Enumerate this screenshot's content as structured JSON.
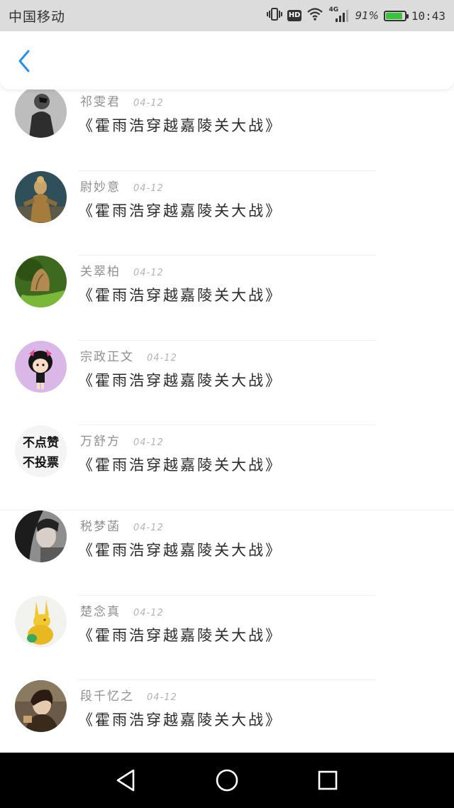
{
  "status_bar": {
    "carrier": "中国移动",
    "network_badge": "HD",
    "network_type": "4G",
    "battery_percent": "91%",
    "battery_level": 0.91,
    "time": "10:43"
  },
  "header": {
    "back_icon": "chevron-left-icon",
    "accent_color": "#2a8ef0"
  },
  "comments": [
    {
      "username": "祁雯君",
      "date": "04-12",
      "text": "《霍雨浩穿越嘉陵关大战》",
      "avatar": "grayscale-person-photo"
    },
    {
      "username": "尉妙意",
      "date": "04-12",
      "text": "《霍雨浩穿越嘉陵关大战》",
      "avatar": "statue-figure-photo"
    },
    {
      "username": "关翠柏",
      "date": "04-12",
      "text": "《霍雨浩穿越嘉陵关大战》",
      "avatar": "butterfly-photo"
    },
    {
      "username": "宗政正文",
      "date": "04-12",
      "text": "《霍雨浩穿越嘉陵关大战》",
      "avatar": "cartoon-girl-photo"
    },
    {
      "username": "万舒方",
      "date": "04-12",
      "text": "《霍雨浩穿越嘉陵关大战》",
      "avatar": "text-image",
      "avatar_text_line1": "不点赞",
      "avatar_text_line2": "不投票"
    },
    {
      "username": "税梦菡",
      "date": "04-12",
      "text": "《霍雨浩穿越嘉陵关大战》",
      "avatar": "woman-portrait-photo"
    },
    {
      "username": "楚念真",
      "date": "04-12",
      "text": "《霍雨浩穿越嘉陵关大战》",
      "avatar": "yellow-rabbit-figure-photo"
    },
    {
      "username": "段千忆之",
      "date": "04-12",
      "text": "《霍雨浩穿越嘉陵关大战》",
      "avatar": "person-photo"
    }
  ],
  "nav_bar": {
    "back_icon": "triangle-back-icon",
    "home_icon": "circle-home-icon",
    "recents_icon": "square-recents-icon"
  }
}
